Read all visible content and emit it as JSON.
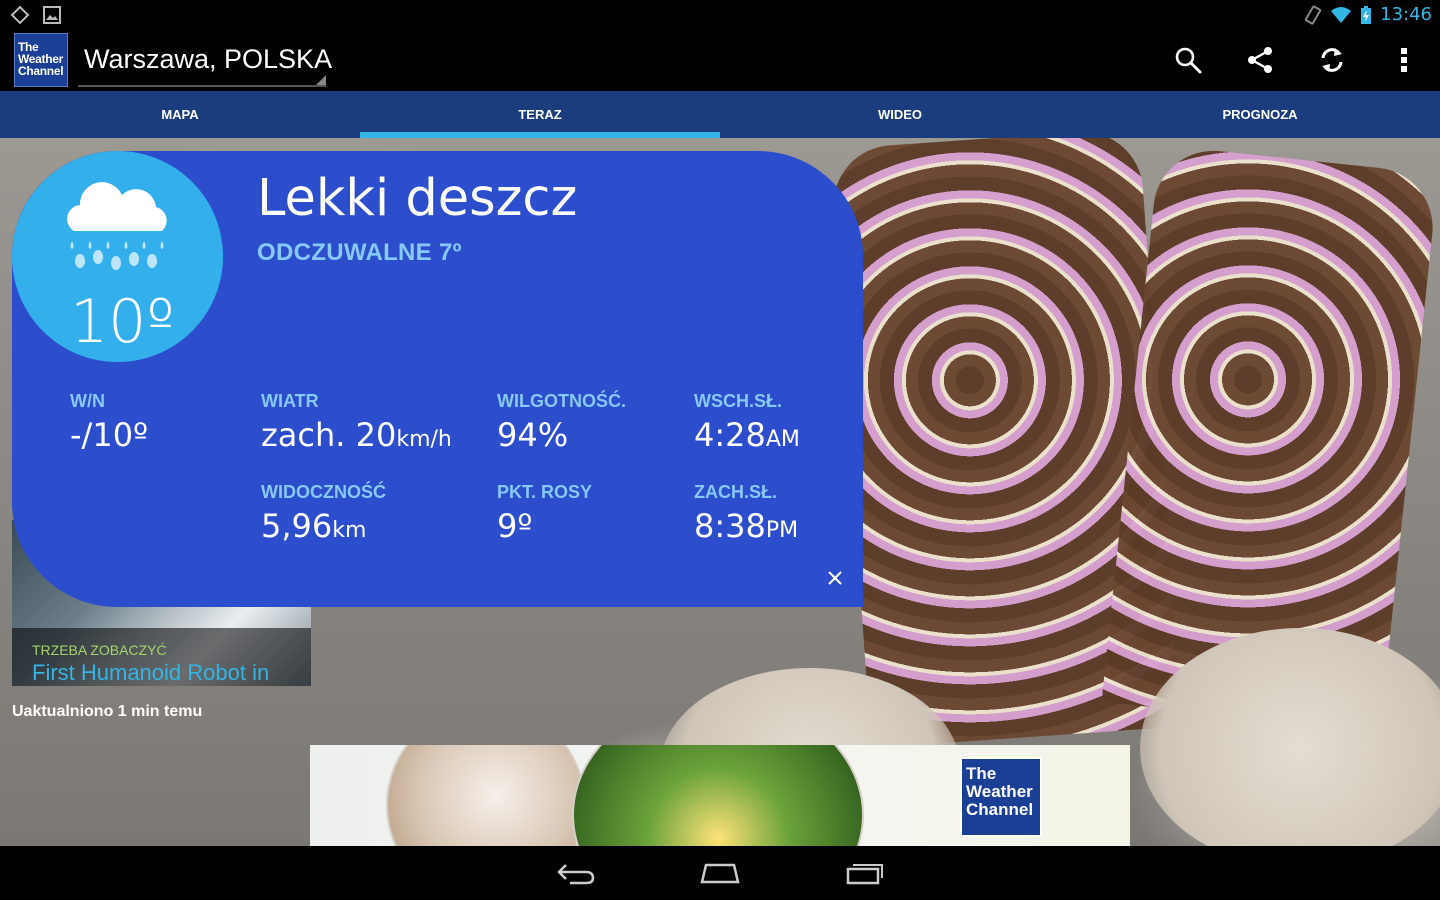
{
  "status_bar": {
    "time": "13:46",
    "colors": {
      "time": "#33b5e5"
    }
  },
  "app_bar": {
    "logo": {
      "line1": "The",
      "line2": "Weather",
      "line3": "Channel"
    },
    "location": "Warszawa, POLSKA",
    "icons": [
      "search-icon",
      "share-icon",
      "refresh-icon",
      "overflow-menu-icon"
    ]
  },
  "tabs": [
    {
      "label": "MAPA",
      "active": false
    },
    {
      "label": "TERAZ",
      "active": true
    },
    {
      "label": "WIDEO",
      "active": false
    },
    {
      "label": "PROGNOZA",
      "active": false
    }
  ],
  "current": {
    "temperature": "10º",
    "condition": "Lekki deszcz",
    "feels_like": "ODCZUWALNE 7º",
    "icon": "rain-cloud-icon",
    "stats": {
      "high_low": {
        "label": "W/N",
        "value": "-/10º"
      },
      "wind": {
        "label": "WIATR",
        "value": "zach. 20",
        "unit": "km/h"
      },
      "humidity": {
        "label": "WILGOTNOŚĆ.",
        "value": "94%"
      },
      "sunrise": {
        "label": "WSCH.SŁ.",
        "value": "4:28",
        "unit": "AM"
      },
      "visibility": {
        "label": "WIDOCZNOŚĆ",
        "value": "5,96",
        "unit": "km"
      },
      "dew_point": {
        "label": "PKT. ROSY",
        "value": "9º"
      },
      "sunset": {
        "label": "ZACH.SŁ.",
        "value": "8:38",
        "unit": "PM"
      }
    },
    "colors": {
      "card": "#2c4dcc",
      "circle": "#33b0ec",
      "label": "#87c9f5"
    }
  },
  "video": {
    "label": "TRZEBA ZOBACZYĆ",
    "title": "First Humanoid Robot in"
  },
  "updated": "Uaktualniono 1 min temu",
  "ad": {
    "logo": {
      "line1": "The",
      "line2": "Weather",
      "line3": "Channel"
    }
  }
}
